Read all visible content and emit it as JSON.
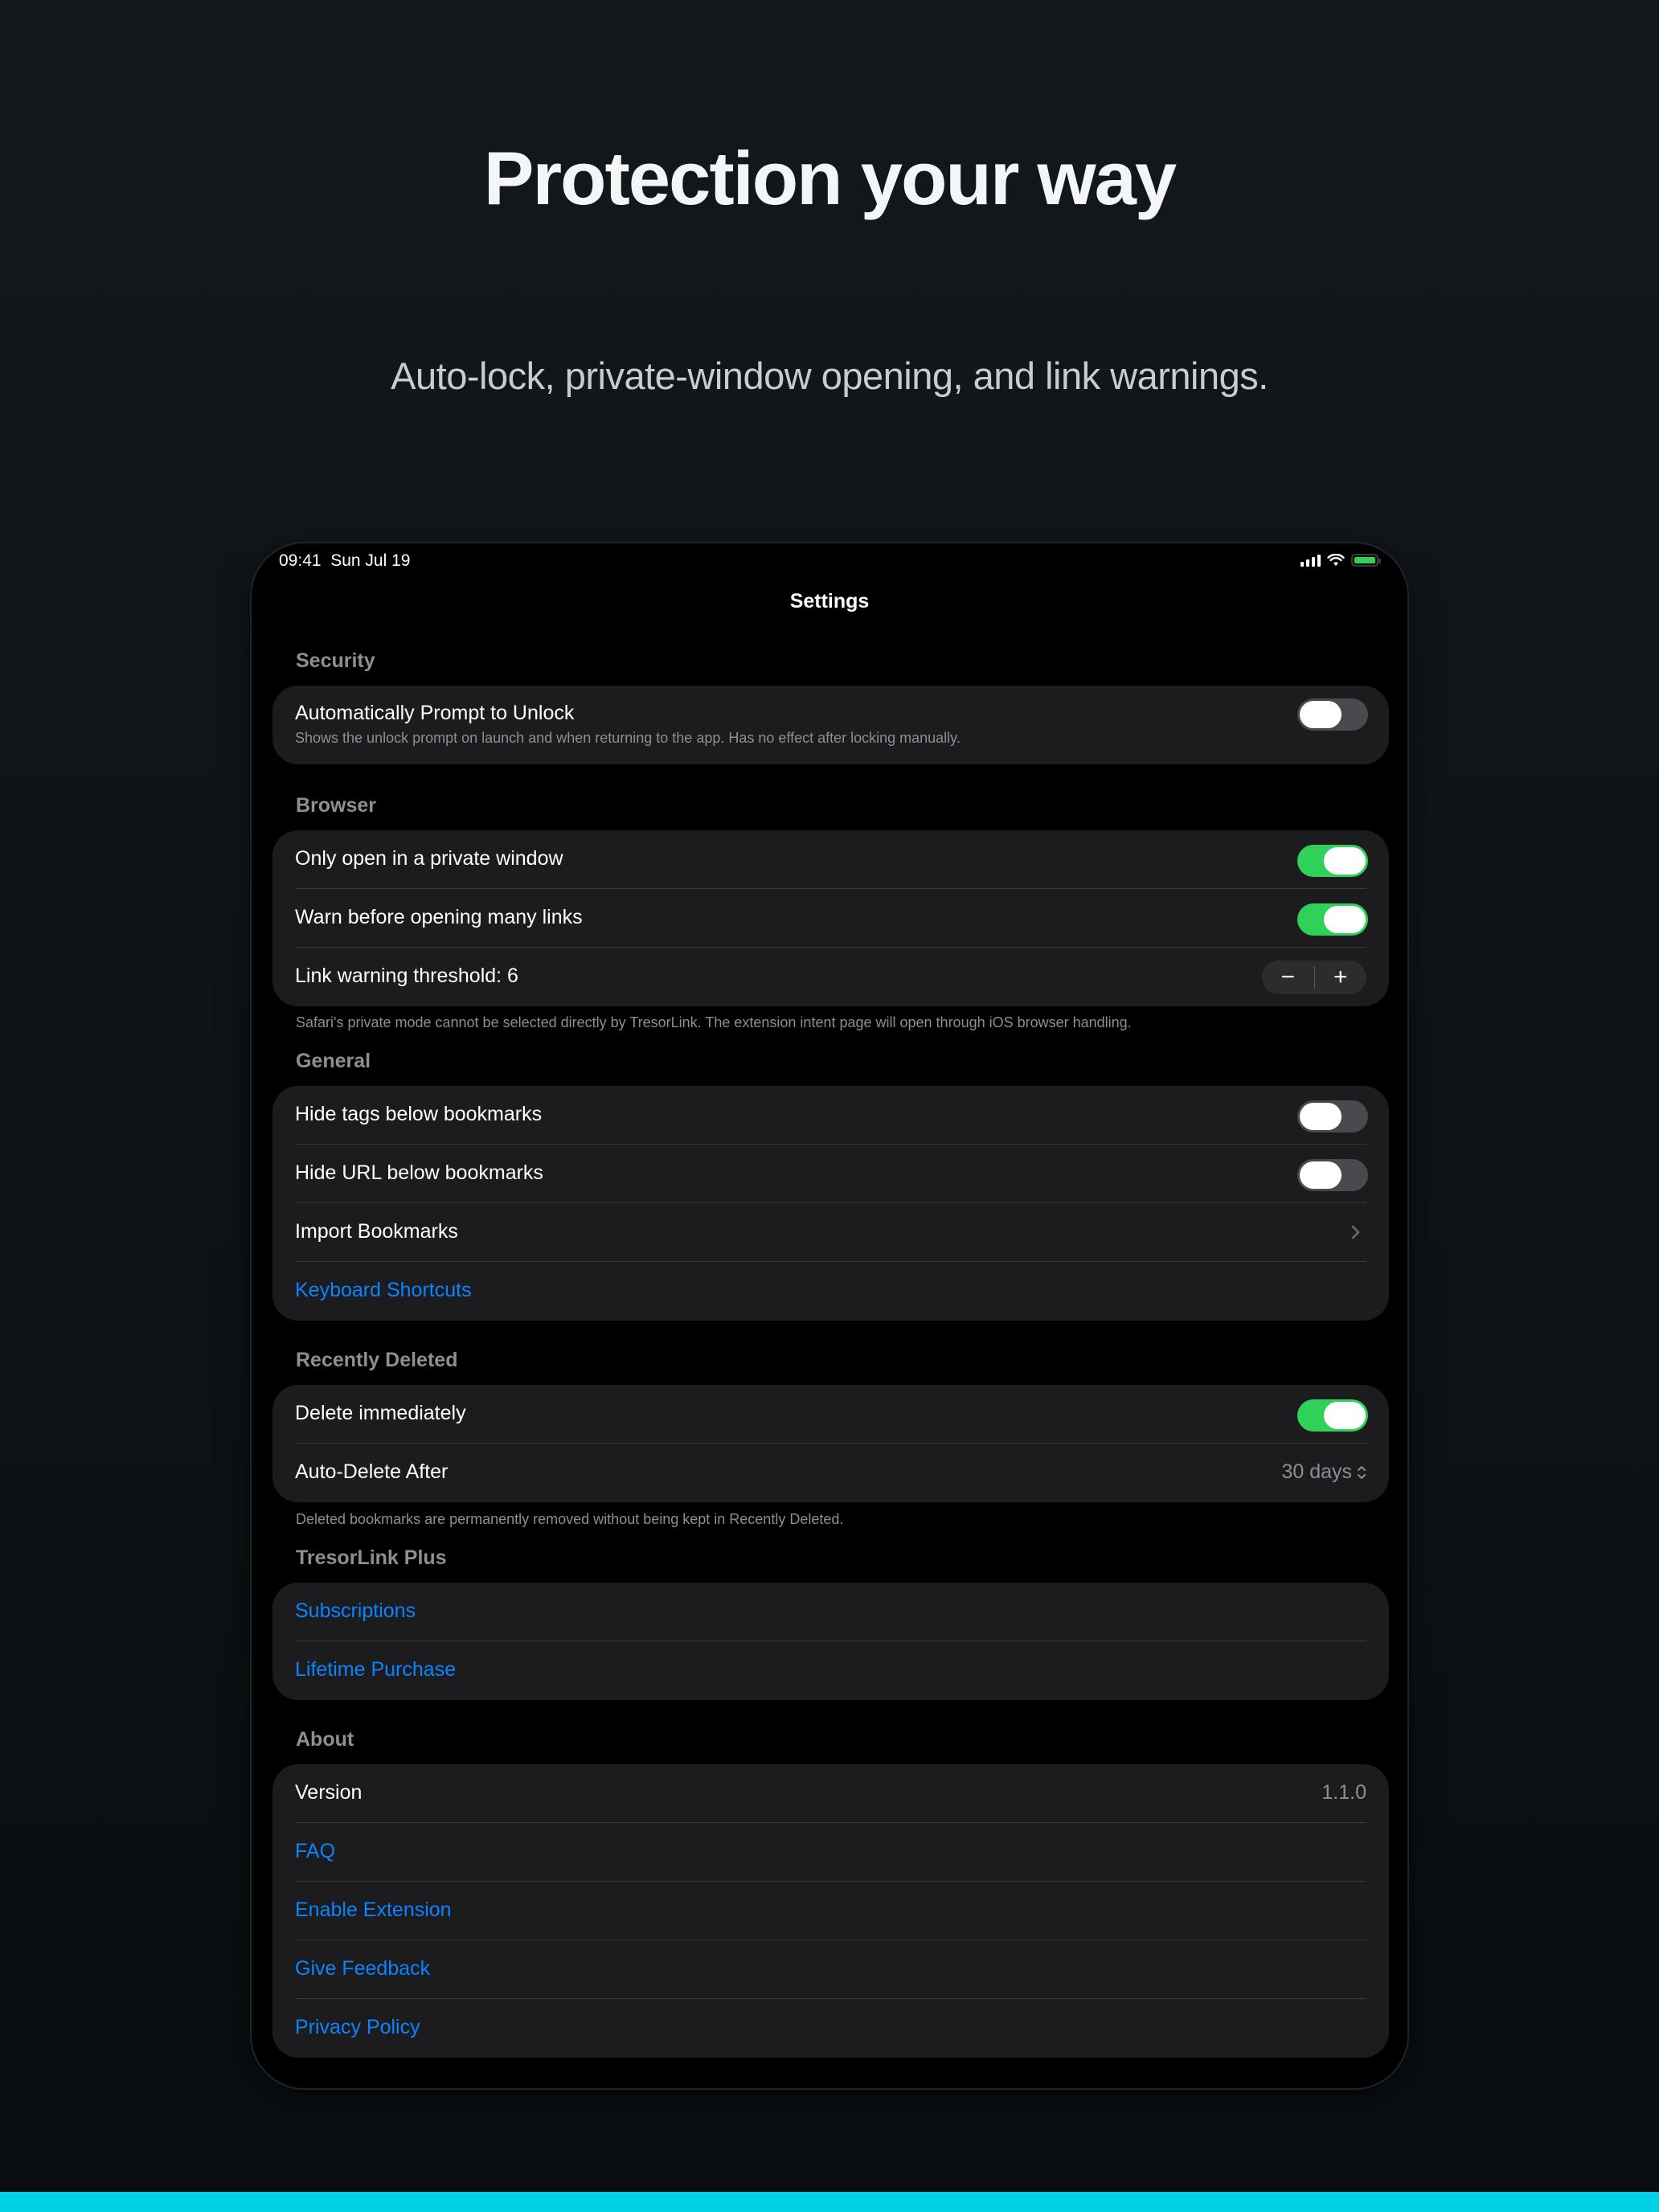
{
  "hero": {
    "title": "Protection your way",
    "subtitle": "Auto-lock, private-window opening, and link warnings."
  },
  "status_bar": {
    "time": "09:41",
    "date": "Sun Jul 19",
    "icons": [
      "signal-icon",
      "wifi-icon",
      "battery-charging-icon"
    ]
  },
  "nav": {
    "title": "Settings"
  },
  "sections": {
    "security": {
      "header": "Security",
      "auto_prompt": {
        "label": "Automatically Prompt to Unlock",
        "subtitle": "Shows the unlock prompt on launch and when returning to the app. Has no effect after locking manually.",
        "enabled": false
      }
    },
    "browser": {
      "header": "Browser",
      "private_window": {
        "label": "Only open in a private window",
        "enabled": true
      },
      "warn_many_links": {
        "label": "Warn before opening many links",
        "enabled": true
      },
      "threshold": {
        "label": "Link warning threshold: 6",
        "minus": "−",
        "plus": "+"
      },
      "footer": "Safari's private mode cannot be selected directly by TresorLink. The extension intent page will open through iOS browser handling."
    },
    "general": {
      "header": "General",
      "hide_tags": {
        "label": "Hide tags below bookmarks",
        "enabled": false
      },
      "hide_url": {
        "label": "Hide URL below bookmarks",
        "enabled": false
      },
      "import": {
        "label": "Import Bookmarks"
      },
      "shortcuts": {
        "label": "Keyboard Shortcuts"
      }
    },
    "recently_deleted": {
      "header": "Recently Deleted",
      "delete_immediately": {
        "label": "Delete immediately",
        "enabled": true
      },
      "auto_delete": {
        "label": "Auto-Delete After",
        "value": "30 days"
      },
      "footer": "Deleted bookmarks are permanently removed without being kept in Recently Deleted."
    },
    "plus": {
      "header": "TresorLink Plus",
      "subscriptions": "Subscriptions",
      "lifetime": "Lifetime Purchase"
    },
    "about": {
      "header": "About",
      "version_label": "Version",
      "version_value": "1.1.0",
      "faq": "FAQ",
      "enable_extension": "Enable Extension",
      "feedback": "Give Feedback",
      "privacy": "Privacy Policy"
    }
  },
  "colors": {
    "accent_link": "#0a84ff",
    "toggle_on": "#30d158",
    "bottom_bar": "#00d2e6"
  }
}
